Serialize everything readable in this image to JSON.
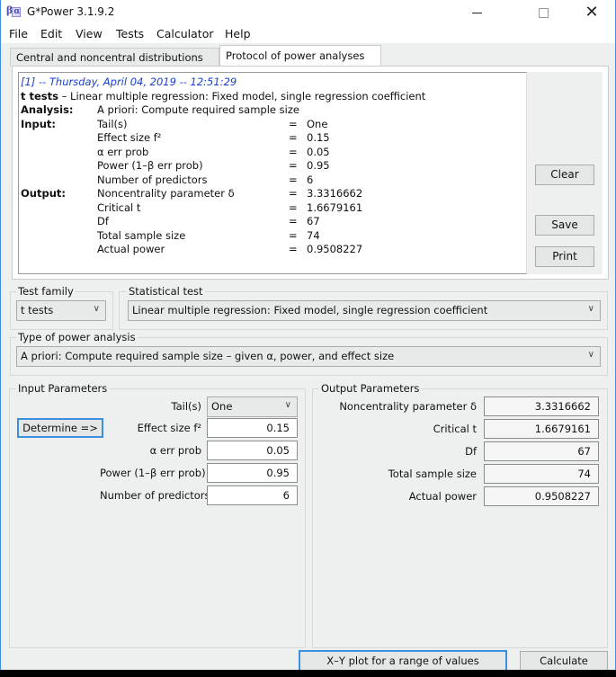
{
  "window": {
    "title": "G*Power 3.1.9.2",
    "icon": "gpower-beta-alpha-icon",
    "controls": {
      "minimize": "minimize-icon",
      "maximize": "maximize-icon",
      "close": "close-icon",
      "close_glyph": "✕"
    }
  },
  "menu": [
    "File",
    "Edit",
    "View",
    "Tests",
    "Calculator",
    "Help"
  ],
  "tabs": [
    {
      "label": "Central and noncentral distributions",
      "active": false
    },
    {
      "label": "Protocol of power analyses",
      "active": true
    }
  ],
  "protocol": {
    "header": "[1] -- Thursday, April 04, 2019 -- 12:51:29",
    "test_line_bold": "t tests",
    "test_line_rest": " – Linear multiple regression: Fixed model, single regression coefficient",
    "analysis_label": "Analysis:",
    "analysis_value": "A priori: Compute required sample size",
    "input_label": "Input:",
    "output_label": "Output:",
    "equals": "=",
    "inputs": [
      {
        "name": "Tail(s)",
        "value": "One"
      },
      {
        "name": "Effect size f²",
        "value": "0.15"
      },
      {
        "name": "α err prob",
        "value": "0.05"
      },
      {
        "name": "Power (1–β err prob)",
        "value": "0.95"
      },
      {
        "name": "Number of predictors",
        "value": "6"
      }
    ],
    "outputs": [
      {
        "name": "Noncentrality parameter δ",
        "value": "3.3316662"
      },
      {
        "name": "Critical t",
        "value": "1.6679161"
      },
      {
        "name": "Df",
        "value": "67"
      },
      {
        "name": "Total sample size",
        "value": "74"
      },
      {
        "name": "Actual power",
        "value": "0.9508227"
      }
    ],
    "buttons": {
      "clear": "Clear",
      "save": "Save",
      "print": "Print"
    }
  },
  "selectors": {
    "test_family_label": "Test family",
    "test_family_value": "t tests",
    "statistical_test_label": "Statistical test",
    "statistical_test_value": "Linear multiple regression: Fixed model, single regression coefficient",
    "type_label": "Type of power analysis",
    "type_value": "A priori: Compute required sample size – given α, power, and effect size",
    "chevron": "∨"
  },
  "input_parameters": {
    "title": "Input Parameters",
    "determine_label": "Determine =>",
    "tails_label": "Tail(s)",
    "tails_value": "One",
    "fields": [
      {
        "label": "Effect size f²",
        "value": "0.15"
      },
      {
        "label": "α err prob",
        "value": "0.05"
      },
      {
        "label": "Power (1–β err prob)",
        "value": "0.95"
      },
      {
        "label": "Number of predictors",
        "value": "6"
      }
    ]
  },
  "output_parameters": {
    "title": "Output Parameters",
    "fields": [
      {
        "label": "Noncentrality parameter δ",
        "value": "3.3316662"
      },
      {
        "label": "Critical t",
        "value": "1.6679161"
      },
      {
        "label": "Df",
        "value": "67"
      },
      {
        "label": "Total sample size",
        "value": "74"
      },
      {
        "label": "Actual power",
        "value": "0.9508227"
      }
    ]
  },
  "actions": {
    "xy_plot": "X–Y plot for a range of values",
    "calculate": "Calculate"
  }
}
